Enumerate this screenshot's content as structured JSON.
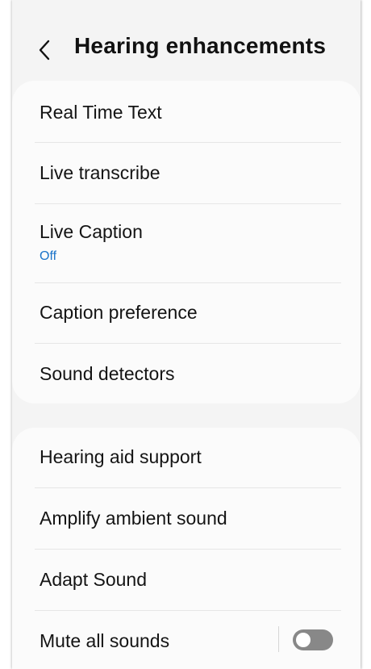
{
  "header": {
    "title": "Hearing enhancements",
    "back_icon": "chevron-left-icon"
  },
  "group1": {
    "items": [
      {
        "label": "Real Time Text"
      },
      {
        "label": "Live transcribe"
      },
      {
        "label": "Live Caption",
        "status": "Off"
      },
      {
        "label": "Caption preference"
      },
      {
        "label": "Sound detectors"
      }
    ]
  },
  "group2": {
    "items": [
      {
        "label": "Hearing aid support"
      },
      {
        "label": "Amplify ambient sound"
      },
      {
        "label": "Adapt Sound"
      },
      {
        "label": "Mute all sounds",
        "toggle": "off"
      }
    ]
  },
  "colors": {
    "status_accent": "#1a73c9",
    "toggle_off": "#888888",
    "background": "#f4f4f4",
    "card": "#fbfbfb"
  }
}
